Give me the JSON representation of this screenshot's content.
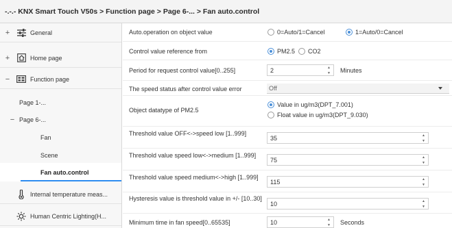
{
  "breadcrumb": "-.-.- KNX Smart Touch V50s > Function page > Page 6-... > Fan auto.control",
  "sidebar": {
    "general": {
      "toggle": "+",
      "label": "General"
    },
    "home": {
      "toggle": "+",
      "label": "Home page"
    },
    "function": {
      "toggle": "−",
      "label": "Function page"
    },
    "page1": {
      "label": "Page 1-..."
    },
    "page6": {
      "toggle": "−",
      "label": "Page 6-..."
    },
    "fan": {
      "label": "Fan"
    },
    "scene": {
      "label": "Scene"
    },
    "fan_auto": {
      "label": "Fan auto.control"
    },
    "internal_temp": {
      "label": "Internal temperature meas..."
    },
    "hcl": {
      "label": "Human Centric Lighting(H..."
    }
  },
  "form": {
    "auto_operation": {
      "label": "Auto.operation on object value",
      "options": [
        "0=Auto/1=Cancel",
        "1=Auto/0=Cancel"
      ],
      "selected": 1
    },
    "control_ref": {
      "label": "Control value reference from",
      "options": [
        "PM2.5",
        "CO2"
      ],
      "selected": 0
    },
    "period": {
      "label": "Period for request control value[0..255]",
      "value": "2",
      "unit": "Minutes"
    },
    "speed_status": {
      "label": "The speed status after control value error",
      "value": "Off"
    },
    "datatype": {
      "label": "Object datatype of PM2.5",
      "options": [
        "Value in ug/m3(DPT_7.001)",
        "Float value in ug/m3(DPT_9.030)"
      ],
      "selected": 0
    },
    "thr_off_low": {
      "label": "Threshold value OFF<->speed low [1..999]",
      "value": "35"
    },
    "thr_low_med": {
      "label": "Threshold value speed low<->medium [1..999]",
      "value": "75"
    },
    "thr_med_high": {
      "label": "Threshold value speed medium<->high [1..999]",
      "value": "115"
    },
    "hysteresis": {
      "label": "Hysteresis value is threshold value in +/- [10..30]",
      "value": "10"
    },
    "min_time": {
      "label": "Minimum time in fan speed[0..65535]",
      "value": "10",
      "unit": "Seconds"
    }
  },
  "colors": {
    "accent": "#2d8cf0",
    "radio": "#4a8fd8"
  }
}
